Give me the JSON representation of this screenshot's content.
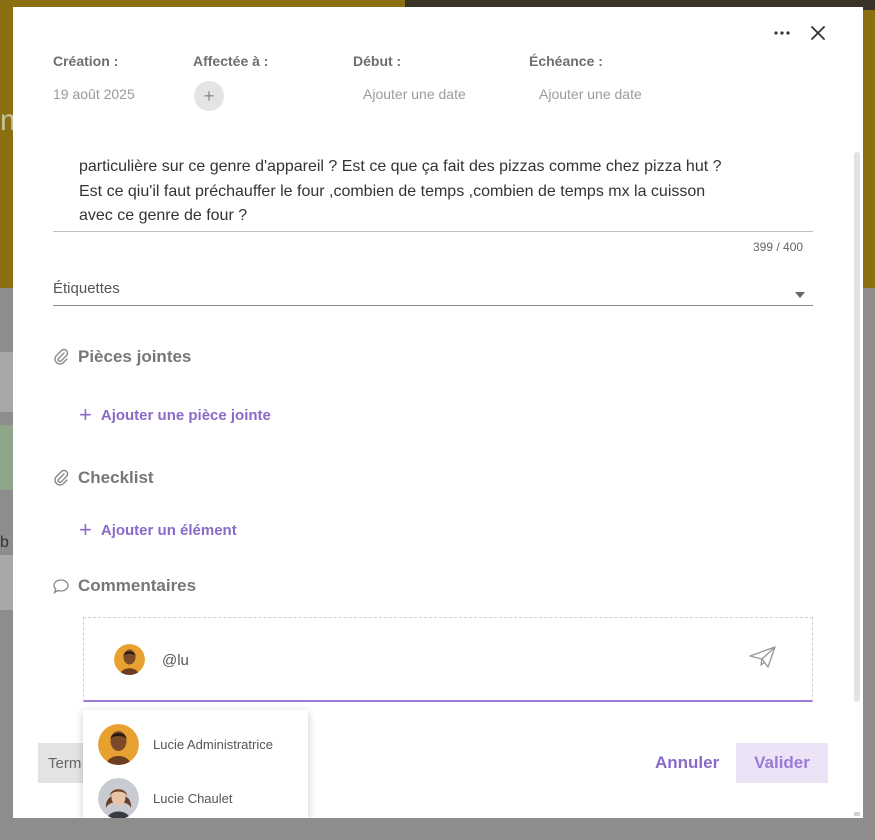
{
  "backdrop": {
    "glyph_top": "m",
    "glyph_bottom": "b"
  },
  "meta": {
    "creation_label": "Création :",
    "creation_value": "19 août 2025",
    "assigned_label": "Affectée à :",
    "start_label": "Début :",
    "start_placeholder": "Ajouter une date",
    "due_label": "Échéance :",
    "due_placeholder": "Ajouter une date"
  },
  "description": {
    "lines": [
      "particulière sur ce genre d'appareil ? Est ce que ça fait des pizzas comme chez pizza hut ?",
      "Est ce qiu'il faut préchauffer le four ,combien de temps ,combien de temps mx la cuisson",
      "avec ce genre de four ?"
    ],
    "counter": "399 / 400"
  },
  "tags": {
    "label": "Étiquettes"
  },
  "attachments": {
    "title": "Pièces jointes",
    "add_label": "Ajouter une pièce jointe"
  },
  "checklist": {
    "title": "Checklist",
    "add_label": "Ajouter un élément"
  },
  "comments": {
    "title": "Commentaires",
    "input_value": "@lu"
  },
  "mentions": [
    {
      "name": "Lucie Administratrice"
    },
    {
      "name": "Lucie Chaulet"
    }
  ],
  "footer": {
    "left_label": "Term",
    "cancel_label": "Annuler",
    "validate_label": "Valider"
  },
  "colors": {
    "accent": "#8a6ac8",
    "validate_bg": "#ede3f7",
    "banner": "#8a7012"
  }
}
